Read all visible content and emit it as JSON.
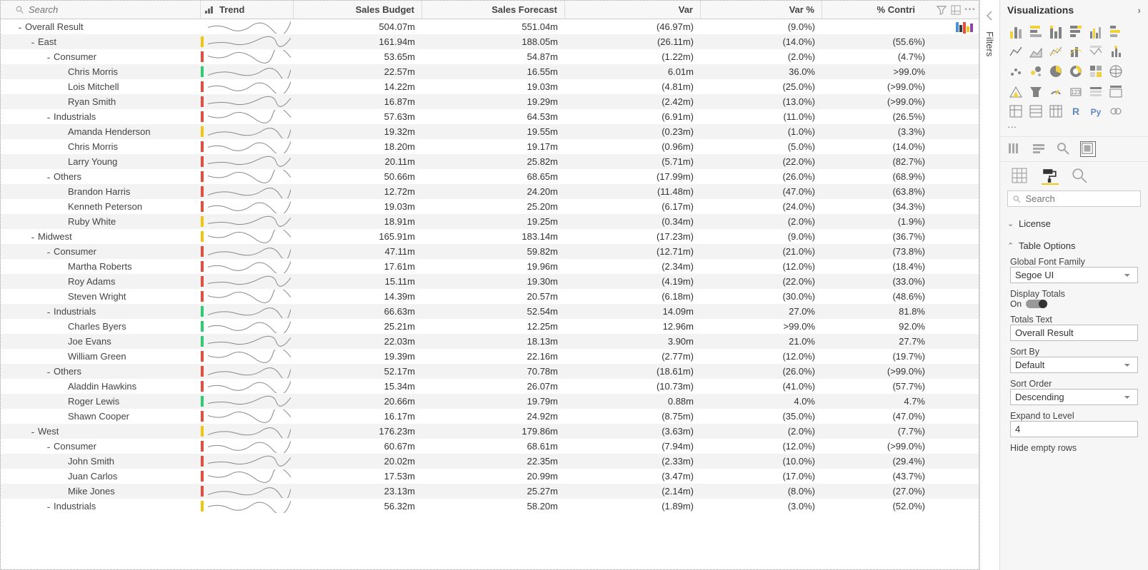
{
  "headers": {
    "search_ph": "Search",
    "trend": "Trend",
    "budget": "Sales Budget",
    "forecast": "Sales Forecast",
    "var": "Var",
    "varp": "Var %",
    "contri": "% Contri"
  },
  "rows": [
    {
      "lvl": 0,
      "exp": "-",
      "name": "Overall Result",
      "bar": "",
      "budget": "504.07m",
      "fc": "551.04m",
      "var": "(46.97m)",
      "vp": "(9.0%)",
      "ct": ""
    },
    {
      "lvl": 1,
      "exp": "-",
      "name": "East",
      "bar": "yellow",
      "budget": "161.94m",
      "fc": "188.05m",
      "var": "(26.11m)",
      "vp": "(14.0%)",
      "ct": "(55.6%)"
    },
    {
      "lvl": 2,
      "exp": "-",
      "name": "Consumer",
      "bar": "red",
      "budget": "53.65m",
      "fc": "54.87m",
      "var": "(1.22m)",
      "vp": "(2.0%)",
      "ct": "(4.7%)"
    },
    {
      "lvl": 3,
      "exp": "",
      "name": "Chris Morris",
      "bar": "green",
      "budget": "22.57m",
      "fc": "16.55m",
      "var": "6.01m",
      "vp": "36.0%",
      "ct": ">99.0%"
    },
    {
      "lvl": 3,
      "exp": "",
      "name": "Lois Mitchell",
      "bar": "red",
      "budget": "14.22m",
      "fc": "19.03m",
      "var": "(4.81m)",
      "vp": "(25.0%)",
      "ct": "(>99.0%)"
    },
    {
      "lvl": 3,
      "exp": "",
      "name": "Ryan Smith",
      "bar": "red",
      "budget": "16.87m",
      "fc": "19.29m",
      "var": "(2.42m)",
      "vp": "(13.0%)",
      "ct": "(>99.0%)"
    },
    {
      "lvl": 2,
      "exp": "-",
      "name": "Industrials",
      "bar": "red",
      "budget": "57.63m",
      "fc": "64.53m",
      "var": "(6.91m)",
      "vp": "(11.0%)",
      "ct": "(26.5%)"
    },
    {
      "lvl": 3,
      "exp": "",
      "name": "Amanda Henderson",
      "bar": "yellow",
      "budget": "19.32m",
      "fc": "19.55m",
      "var": "(0.23m)",
      "vp": "(1.0%)",
      "ct": "(3.3%)"
    },
    {
      "lvl": 3,
      "exp": "",
      "name": "Chris Morris",
      "bar": "red",
      "budget": "18.20m",
      "fc": "19.17m",
      "var": "(0.96m)",
      "vp": "(5.0%)",
      "ct": "(14.0%)"
    },
    {
      "lvl": 3,
      "exp": "",
      "name": "Larry Young",
      "bar": "red",
      "budget": "20.11m",
      "fc": "25.82m",
      "var": "(5.71m)",
      "vp": "(22.0%)",
      "ct": "(82.7%)"
    },
    {
      "lvl": 2,
      "exp": "-",
      "name": "Others",
      "bar": "red",
      "budget": "50.66m",
      "fc": "68.65m",
      "var": "(17.99m)",
      "vp": "(26.0%)",
      "ct": "(68.9%)"
    },
    {
      "lvl": 3,
      "exp": "",
      "name": "Brandon Harris",
      "bar": "red",
      "budget": "12.72m",
      "fc": "24.20m",
      "var": "(11.48m)",
      "vp": "(47.0%)",
      "ct": "(63.8%)"
    },
    {
      "lvl": 3,
      "exp": "",
      "name": "Kenneth Peterson",
      "bar": "red",
      "budget": "19.03m",
      "fc": "25.20m",
      "var": "(6.17m)",
      "vp": "(24.0%)",
      "ct": "(34.3%)"
    },
    {
      "lvl": 3,
      "exp": "",
      "name": "Ruby White",
      "bar": "yellow",
      "budget": "18.91m",
      "fc": "19.25m",
      "var": "(0.34m)",
      "vp": "(2.0%)",
      "ct": "(1.9%)"
    },
    {
      "lvl": 1,
      "exp": "-",
      "name": "Midwest",
      "bar": "yellow",
      "budget": "165.91m",
      "fc": "183.14m",
      "var": "(17.23m)",
      "vp": "(9.0%)",
      "ct": "(36.7%)"
    },
    {
      "lvl": 2,
      "exp": "-",
      "name": "Consumer",
      "bar": "red",
      "budget": "47.11m",
      "fc": "59.82m",
      "var": "(12.71m)",
      "vp": "(21.0%)",
      "ct": "(73.8%)"
    },
    {
      "lvl": 3,
      "exp": "",
      "name": "Martha Roberts",
      "bar": "red",
      "budget": "17.61m",
      "fc": "19.96m",
      "var": "(2.34m)",
      "vp": "(12.0%)",
      "ct": "(18.4%)"
    },
    {
      "lvl": 3,
      "exp": "",
      "name": "Roy Adams",
      "bar": "red",
      "budget": "15.11m",
      "fc": "19.30m",
      "var": "(4.19m)",
      "vp": "(22.0%)",
      "ct": "(33.0%)"
    },
    {
      "lvl": 3,
      "exp": "",
      "name": "Steven Wright",
      "bar": "red",
      "budget": "14.39m",
      "fc": "20.57m",
      "var": "(6.18m)",
      "vp": "(30.0%)",
      "ct": "(48.6%)"
    },
    {
      "lvl": 2,
      "exp": "-",
      "name": "Industrials",
      "bar": "green",
      "budget": "66.63m",
      "fc": "52.54m",
      "var": "14.09m",
      "vp": "27.0%",
      "ct": "81.8%"
    },
    {
      "lvl": 3,
      "exp": "",
      "name": "Charles Byers",
      "bar": "green",
      "budget": "25.21m",
      "fc": "12.25m",
      "var": "12.96m",
      "vp": ">99.0%",
      "ct": "92.0%"
    },
    {
      "lvl": 3,
      "exp": "",
      "name": "Joe Evans",
      "bar": "green",
      "budget": "22.03m",
      "fc": "18.13m",
      "var": "3.90m",
      "vp": "21.0%",
      "ct": "27.7%"
    },
    {
      "lvl": 3,
      "exp": "",
      "name": "William Green",
      "bar": "red",
      "budget": "19.39m",
      "fc": "22.16m",
      "var": "(2.77m)",
      "vp": "(12.0%)",
      "ct": "(19.7%)"
    },
    {
      "lvl": 2,
      "exp": "-",
      "name": "Others",
      "bar": "red",
      "budget": "52.17m",
      "fc": "70.78m",
      "var": "(18.61m)",
      "vp": "(26.0%)",
      "ct": "(>99.0%)"
    },
    {
      "lvl": 3,
      "exp": "",
      "name": "Aladdin Hawkins",
      "bar": "red",
      "budget": "15.34m",
      "fc": "26.07m",
      "var": "(10.73m)",
      "vp": "(41.0%)",
      "ct": "(57.7%)"
    },
    {
      "lvl": 3,
      "exp": "",
      "name": "Roger Lewis",
      "bar": "green",
      "budget": "20.66m",
      "fc": "19.79m",
      "var": "0.88m",
      "vp": "4.0%",
      "ct": "4.7%"
    },
    {
      "lvl": 3,
      "exp": "",
      "name": "Shawn Cooper",
      "bar": "red",
      "budget": "16.17m",
      "fc": "24.92m",
      "var": "(8.75m)",
      "vp": "(35.0%)",
      "ct": "(47.0%)"
    },
    {
      "lvl": 1,
      "exp": "-",
      "name": "West",
      "bar": "yellow",
      "budget": "176.23m",
      "fc": "179.86m",
      "var": "(3.63m)",
      "vp": "(2.0%)",
      "ct": "(7.7%)"
    },
    {
      "lvl": 2,
      "exp": "-",
      "name": "Consumer",
      "bar": "red",
      "budget": "60.67m",
      "fc": "68.61m",
      "var": "(7.94m)",
      "vp": "(12.0%)",
      "ct": "(>99.0%)"
    },
    {
      "lvl": 3,
      "exp": "",
      "name": "John Smith",
      "bar": "red",
      "budget": "20.02m",
      "fc": "22.35m",
      "var": "(2.33m)",
      "vp": "(10.0%)",
      "ct": "(29.4%)"
    },
    {
      "lvl": 3,
      "exp": "",
      "name": "Juan Carlos",
      "bar": "red",
      "budget": "17.53m",
      "fc": "20.99m",
      "var": "(3.47m)",
      "vp": "(17.0%)",
      "ct": "(43.7%)"
    },
    {
      "lvl": 3,
      "exp": "",
      "name": "Mike Jones",
      "bar": "red",
      "budget": "23.13m",
      "fc": "25.27m",
      "var": "(2.14m)",
      "vp": "(8.0%)",
      "ct": "(27.0%)"
    },
    {
      "lvl": 2,
      "exp": "-",
      "name": "Industrials",
      "bar": "yellow",
      "budget": "56.32m",
      "fc": "58.20m",
      "var": "(1.89m)",
      "vp": "(3.0%)",
      "ct": "(52.0%)"
    }
  ],
  "panel": {
    "title": "Visualizations",
    "more": "···",
    "search_ph": "Search",
    "license_label": "License",
    "table_opts_label": "Table Options",
    "font_family_label": "Global Font Family",
    "font_family_value": "Segoe UI",
    "display_totals_label": "Display Totals",
    "display_totals_state": "On",
    "totals_text_label": "Totals Text",
    "totals_text_value": "Overall Result",
    "sortby_label": "Sort By",
    "sortby_value": "Default",
    "sortorder_label": "Sort Order",
    "sortorder_value": "Descending",
    "expand_label": "Expand to Level",
    "expand_value": "4",
    "hide_empty_label": "Hide empty rows",
    "hide_empty_state": "Off"
  },
  "filters": {
    "label": "Filters"
  }
}
